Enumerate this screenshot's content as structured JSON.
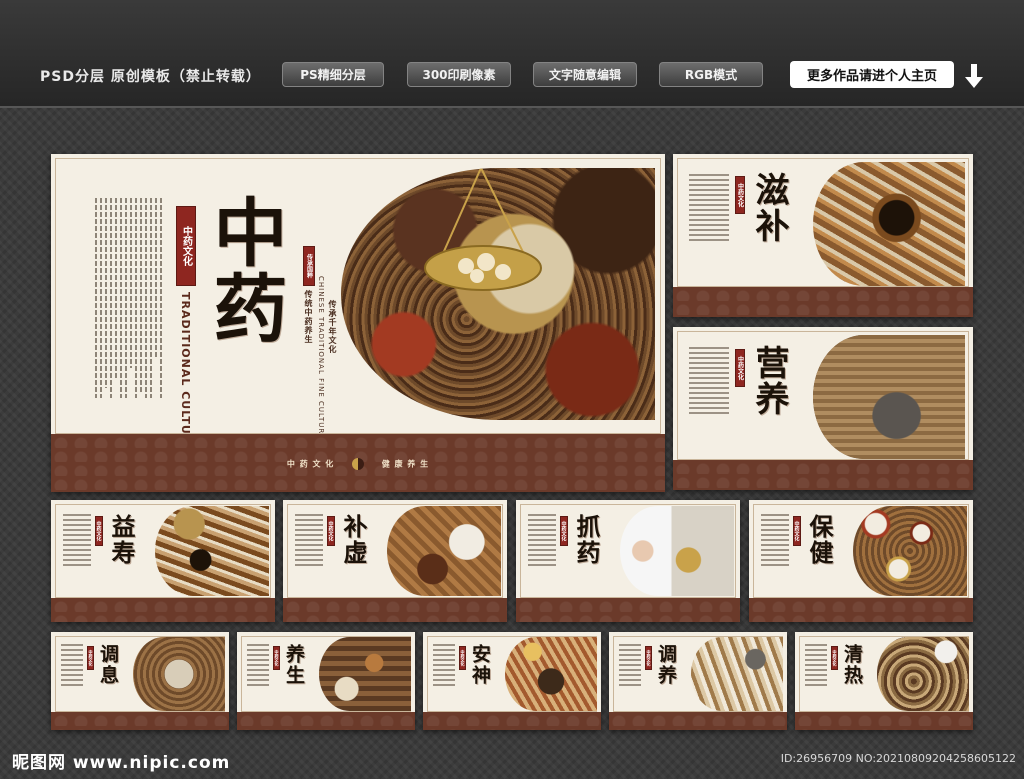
{
  "header": {
    "title": "PSD分层 原创模板（禁止转载）",
    "pills": [
      "PS精细分层",
      "300印刷像素",
      "文字随意编辑",
      "RGB模式"
    ],
    "more": "更多作品请进个人主页",
    "arrow_icon": "down-arrow-icon"
  },
  "main": {
    "title": "中药",
    "tag": "中药文化",
    "tag_en": "TRADITIONAL CULTURE",
    "seal": "传承国粹",
    "slogan1": "传统中药养生",
    "slogan2": "传承千年文化",
    "sub_en": "CHINESE TRADITIONAL FINE CULTURE",
    "footer_left": "中 药 文 化",
    "footer_right": "健 康 养 生"
  },
  "side_panels": [
    {
      "title": "滋补",
      "tag": "中药文化"
    },
    {
      "title": "营养",
      "tag": "中药文化"
    }
  ],
  "row1": [
    {
      "title": "益寿",
      "tag": "中药文化"
    },
    {
      "title": "补虚",
      "tag": "中药文化"
    },
    {
      "title": "抓药",
      "tag": "中药文化"
    },
    {
      "title": "保健",
      "tag": "中药文化"
    }
  ],
  "row2": [
    {
      "title": "调息",
      "tag": "中药文化"
    },
    {
      "title": "养生",
      "tag": "中药文化"
    },
    {
      "title": "安神",
      "tag": "中药文化"
    },
    {
      "title": "调养",
      "tag": "中药文化"
    },
    {
      "title": "清热",
      "tag": "中药文化"
    }
  ],
  "footer": {
    "logo": "昵图网 www.nipic.com",
    "id": "ID:26956709 NO:20210809204258605122"
  },
  "colors": {
    "brown": "#6b3a2a",
    "red": "#8e2620",
    "paper": "#f4efe4"
  }
}
